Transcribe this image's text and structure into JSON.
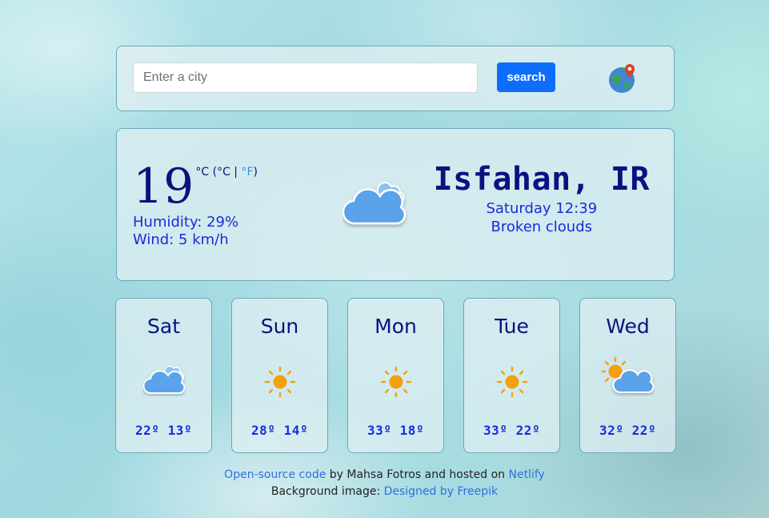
{
  "search": {
    "placeholder": "Enter a city",
    "value": "",
    "button_label": "search",
    "location_icon": "globe-location-icon"
  },
  "current": {
    "temperature": "19",
    "unit_celsius": "°C",
    "unit_open": " (",
    "unit_celsius_link": "°C",
    "unit_separator": " | ",
    "unit_fahrenheit_link": "°F",
    "unit_close": ")",
    "humidity": "Humidity: 29%",
    "wind": "Wind: 5 km/h",
    "icon": "broken-clouds-icon",
    "city": "Isfahan, IR",
    "datetime": "Saturday 12:39",
    "description": "Broken clouds"
  },
  "forecast": [
    {
      "day": "Sat",
      "temps": "22º 13º",
      "icon": "broken-clouds-icon"
    },
    {
      "day": "Sun",
      "temps": "28º 14º",
      "icon": "sun-icon"
    },
    {
      "day": "Mon",
      "temps": "33º 18º",
      "icon": "sun-icon"
    },
    {
      "day": "Tue",
      "temps": "33º 22º",
      "icon": "sun-icon"
    },
    {
      "day": "Wed",
      "temps": "32º 22º",
      "icon": "partly-cloudy-icon"
    }
  ],
  "footer": {
    "source_link": "Open-source code",
    "by_text": " by Mahsa Fotros and hosted on ",
    "host_link": "Netlify",
    "bg_text": "Background image: ",
    "bg_link": "Designed by Freepik"
  },
  "colors": {
    "primary_text": "#0a1280",
    "secondary_text": "#1a2cd6",
    "button": "#0d6efd",
    "link": "#2f6fe0",
    "sun": "#f5a00f",
    "cloud": "#5aa2ea"
  }
}
